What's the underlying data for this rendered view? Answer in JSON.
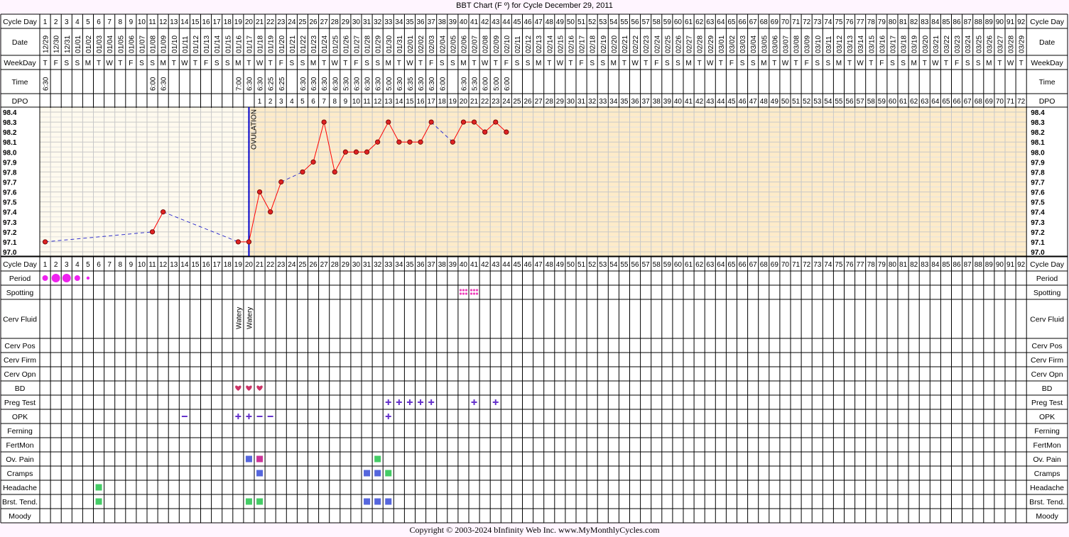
{
  "title": "BBT Chart (F º) for Cycle December 29, 2011",
  "footer": "Copyright © 2003-2024 bInfinity Web Inc.     www.MyMonthlyCycles.com",
  "colors": {
    "background": "#fff5ff",
    "pre_ovulation_fill": "#fffaee",
    "post_ovulation_fill": "#fdebc9",
    "temp_line": "#ff0000",
    "temp_dot": "#dd2222",
    "missing_line": "#3333cc",
    "ovulation_line": "#0000cc",
    "period": "#ee22ee",
    "spotting": "#ee44bb",
    "heart": "#cc3366",
    "plus": "#6633cc",
    "minus": "#6633cc",
    "symptom_blue": "#5566dd",
    "symptom_pink": "#cc3399",
    "symptom_green": "#44cc66"
  },
  "row_labels": [
    "Cycle Day",
    "Date",
    "WeekDay",
    "Time",
    "DPO",
    "Cycle Day",
    "Period",
    "Spotting",
    "Cerv Fluid",
    "Cerv Pos",
    "Cerv Firm",
    "Cerv Opn",
    "BD",
    "Preg Test",
    "OPK",
    "Ferning",
    "FertMon",
    "Ov. Pain",
    "Cramps",
    "Headache",
    "Brst. Tend.",
    "Moody"
  ],
  "ovulation_label": "OVULATION",
  "ovulation_day": 20,
  "cycle_days": [
    1,
    2,
    3,
    4,
    5,
    6,
    7,
    8,
    9,
    10,
    11,
    12,
    13,
    14,
    15,
    16,
    17,
    18,
    19,
    20,
    21,
    22,
    23,
    24,
    25,
    26,
    27,
    28,
    29,
    30,
    31,
    32,
    33,
    34,
    35,
    36,
    37,
    38,
    39,
    40,
    41,
    42,
    43,
    44,
    45,
    46,
    47,
    48,
    49,
    50,
    51,
    52,
    53,
    54,
    55,
    56,
    57,
    58,
    59,
    60,
    61,
    62,
    63,
    64,
    65,
    66,
    67,
    68,
    69,
    70,
    71,
    72,
    73,
    74,
    75,
    76,
    77,
    78,
    79,
    80,
    81,
    82,
    83,
    84,
    85,
    86,
    87,
    88,
    89,
    90,
    91,
    92
  ],
  "dates": [
    "12/29",
    "12/30",
    "12/31",
    "01/01",
    "01/02",
    "01/03",
    "01/04",
    "01/05",
    "01/06",
    "01/07",
    "01/08",
    "01/09",
    "01/10",
    "01/11",
    "01/12",
    "01/13",
    "01/14",
    "01/15",
    "01/16",
    "01/17",
    "01/18",
    "01/19",
    "01/20",
    "01/21",
    "01/22",
    "01/23",
    "01/24",
    "01/25",
    "01/26",
    "01/27",
    "01/28",
    "01/29",
    "01/30",
    "01/31",
    "02/01",
    "02/02",
    "02/03",
    "02/04",
    "02/05",
    "02/06",
    "02/07",
    "02/08",
    "02/09",
    "02/10",
    "02/11",
    "02/12",
    "02/13",
    "02/14",
    "02/15",
    "02/16",
    "02/17",
    "02/18",
    "02/19",
    "02/20",
    "02/21",
    "02/22",
    "02/23",
    "02/24",
    "02/25",
    "02/26",
    "02/27",
    "02/28",
    "02/29",
    "03/01",
    "03/02",
    "03/03",
    "03/04",
    "03/05",
    "03/06",
    "03/07",
    "03/08",
    "03/09",
    "03/10",
    "03/11",
    "03/12",
    "03/13",
    "03/14",
    "03/15",
    "03/16",
    "03/17",
    "03/18",
    "03/19",
    "03/20",
    "03/21",
    "03/22",
    "03/23",
    "03/24",
    "03/25",
    "03/26",
    "03/27",
    "03/28",
    "03/29"
  ],
  "weekdays": [
    "T",
    "F",
    "S",
    "S",
    "M",
    "T",
    "W",
    "T",
    "F",
    "S",
    "S",
    "M",
    "T",
    "W",
    "T",
    "F",
    "S",
    "S",
    "M",
    "T",
    "W",
    "T",
    "F",
    "S",
    "S",
    "M",
    "T",
    "W",
    "T",
    "F",
    "S",
    "S",
    "M",
    "T",
    "W",
    "T",
    "F",
    "S",
    "S",
    "M",
    "T",
    "W",
    "T",
    "F",
    "S",
    "S",
    "M",
    "T",
    "W",
    "T",
    "F",
    "S",
    "S",
    "M",
    "T",
    "W",
    "T",
    "F",
    "S",
    "S",
    "M",
    "T",
    "W",
    "T",
    "F",
    "S",
    "S",
    "M",
    "T",
    "W",
    "T",
    "F",
    "S",
    "S",
    "M",
    "T",
    "W",
    "T",
    "F",
    "S",
    "S",
    "M",
    "T",
    "W",
    "T",
    "F",
    "S",
    "S",
    "M",
    "T",
    "W",
    "T"
  ],
  "times": [
    "6:30",
    "",
    "",
    "",
    "",
    "",
    "",
    "",
    "",
    "",
    "6:00",
    "6:30",
    "",
    "",
    "",
    "",
    "",
    "",
    "7:00",
    "6:30",
    "6:30",
    "6:25",
    "6:25",
    "",
    "6:30",
    "6:30",
    "6:30",
    "6:30",
    "5:30",
    "6:30",
    "6:30",
    "6:30",
    "5:00",
    "6:30",
    "6:35",
    "6:30",
    "6:30",
    "6:00",
    "",
    "6:30",
    "5:30",
    "6:00",
    "5:00",
    "6:00",
    "",
    "",
    "",
    "",
    "",
    "",
    "",
    "",
    "",
    "",
    "",
    "",
    "",
    "",
    "",
    "",
    "",
    "",
    "",
    "",
    "",
    "",
    "",
    "",
    "",
    "",
    "",
    "",
    "",
    "",
    "",
    "",
    "",
    "",
    "",
    "",
    "",
    "",
    "",
    "",
    "",
    "",
    "",
    "",
    "",
    "",
    "",
    "",
    ""
  ],
  "dpo": [
    "",
    "",
    "",
    "",
    "",
    "",
    "",
    "",
    "",
    "",
    "",
    "",
    "",
    "",
    "",
    "",
    "",
    "",
    "",
    "",
    "1",
    "2",
    "3",
    "4",
    "5",
    "6",
    "7",
    "8",
    "9",
    "10",
    "11",
    "12",
    "13",
    "14",
    "15",
    "16",
    "17",
    "18",
    "19",
    "20",
    "21",
    "22",
    "23",
    "24",
    "25",
    "26",
    "27",
    "28",
    "29",
    "30",
    "31",
    "32",
    "33",
    "34",
    "35",
    "36",
    "37",
    "38",
    "39",
    "40",
    "41",
    "42",
    "43",
    "44",
    "45",
    "46",
    "47",
    "48",
    "49",
    "50",
    "51",
    "52",
    "53",
    "54",
    "55",
    "56",
    "57",
    "58",
    "59",
    "60",
    "61",
    "62",
    "63",
    "64",
    "65",
    "66",
    "67",
    "68",
    "69",
    "70",
    "71",
    "72"
  ],
  "chart_data": {
    "type": "line",
    "title": "BBT Chart (F º) for Cycle December 29, 2011",
    "xlabel": "Cycle Day",
    "ylabel": "",
    "ylim": [
      97.0,
      98.4
    ],
    "yticks": [
      "98.4",
      "98.3",
      "98.2",
      "98.1",
      "98.0",
      "97.9",
      "97.8",
      "97.7",
      "97.6",
      "97.5",
      "97.4",
      "97.3",
      "97.2",
      "97.1",
      "97.0"
    ],
    "x": [
      1,
      11,
      12,
      19,
      20,
      21,
      22,
      23,
      25,
      26,
      27,
      28,
      29,
      30,
      31,
      32,
      33,
      34,
      35,
      36,
      37,
      39,
      40,
      41,
      42,
      43,
      44
    ],
    "values": [
      97.1,
      97.2,
      97.4,
      97.1,
      97.1,
      97.6,
      97.4,
      97.7,
      97.8,
      97.9,
      98.3,
      97.8,
      98.0,
      98.0,
      98.0,
      98.1,
      98.3,
      98.1,
      98.1,
      98.1,
      98.3,
      98.1,
      98.3,
      98.3,
      98.2,
      98.3,
      98.2
    ],
    "grid": true,
    "legend": "none"
  },
  "period": [
    {
      "day": 1,
      "size": "medium"
    },
    {
      "day": 2,
      "size": "large"
    },
    {
      "day": 3,
      "size": "large"
    },
    {
      "day": 4,
      "size": "medium"
    },
    {
      "day": 5,
      "size": "small"
    }
  ],
  "spotting_days": [
    40,
    41
  ],
  "cerv_fluid": [
    {
      "day": 19,
      "label": "Watery"
    },
    {
      "day": 20,
      "label": "Watery"
    }
  ],
  "bd_days": [
    19,
    20,
    21
  ],
  "preg_test": [
    {
      "day": 33,
      "mark": "+"
    },
    {
      "day": 34,
      "mark": "+"
    },
    {
      "day": 35,
      "mark": "+"
    },
    {
      "day": 36,
      "mark": "+"
    },
    {
      "day": 37,
      "mark": "+"
    },
    {
      "day": 41,
      "mark": "+"
    },
    {
      "day": 43,
      "mark": "+"
    }
  ],
  "opk": [
    {
      "day": 14,
      "mark": "–"
    },
    {
      "day": 19,
      "mark": "+"
    },
    {
      "day": 20,
      "mark": "+"
    },
    {
      "day": 21,
      "mark": "–"
    },
    {
      "day": 22,
      "mark": "–"
    },
    {
      "day": 33,
      "mark": "+"
    }
  ],
  "symptoms": {
    "ov_pain": [
      {
        "day": 20,
        "color": "blue"
      },
      {
        "day": 21,
        "color": "pink"
      },
      {
        "day": 32,
        "color": "green"
      }
    ],
    "cramps": [
      {
        "day": 21,
        "color": "blue"
      },
      {
        "day": 31,
        "color": "blue"
      },
      {
        "day": 32,
        "color": "blue"
      },
      {
        "day": 33,
        "color": "green"
      }
    ],
    "headache": [
      {
        "day": 6,
        "color": "green"
      }
    ],
    "brst_tend": [
      {
        "day": 6,
        "color": "green"
      },
      {
        "day": 20,
        "color": "green"
      },
      {
        "day": 21,
        "color": "green"
      },
      {
        "day": 31,
        "color": "blue"
      },
      {
        "day": 32,
        "color": "blue"
      },
      {
        "day": 33,
        "color": "blue"
      }
    ]
  }
}
